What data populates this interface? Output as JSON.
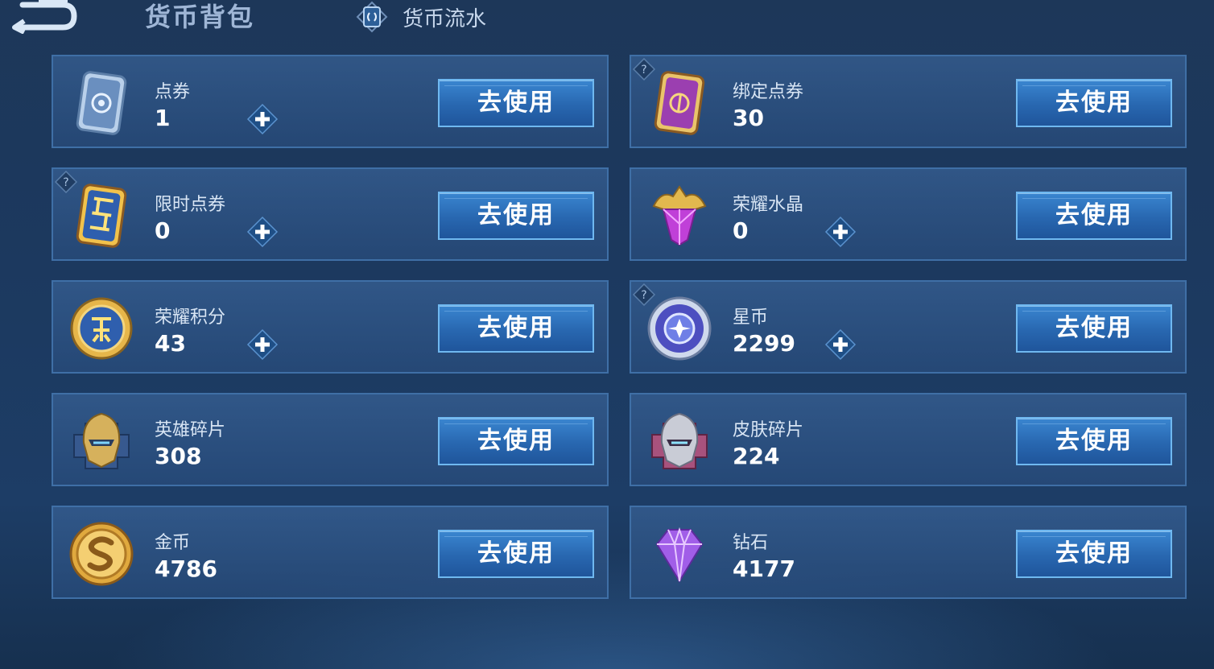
{
  "header": {
    "title": "货币背包",
    "flow_label": "货币流水"
  },
  "use_label": "去使用",
  "currencies": [
    {
      "name": "点券",
      "amount": "1",
      "icon": "ticket-blue-icon"
    },
    {
      "name": "绑定点券",
      "amount": "30",
      "icon": "ticket-purple-icon"
    },
    {
      "name": "限时点券",
      "amount": "0",
      "icon": "limited-ticket-icon"
    },
    {
      "name": "荣耀水晶",
      "amount": "0",
      "icon": "honor-crystal-icon"
    },
    {
      "name": "荣耀积分",
      "amount": "43",
      "icon": "honor-points-coin-icon"
    },
    {
      "name": "星币",
      "amount": "2299",
      "icon": "star-coin-icon"
    },
    {
      "name": "英雄碎片",
      "amount": "308",
      "icon": "hero-fragment-helmet-icon"
    },
    {
      "name": "皮肤碎片",
      "amount": "224",
      "icon": "skin-fragment-helmet-icon"
    },
    {
      "name": "金币",
      "amount": "4786",
      "icon": "gold-coin-icon"
    },
    {
      "name": "钻石",
      "amount": "4177",
      "icon": "diamond-icon"
    }
  ],
  "colors": {
    "background": "#1c395f",
    "card_border": "#3f6fa6",
    "button": "#2867b0",
    "button_border": "#6fb8f0",
    "title": "#9fb6d6"
  }
}
